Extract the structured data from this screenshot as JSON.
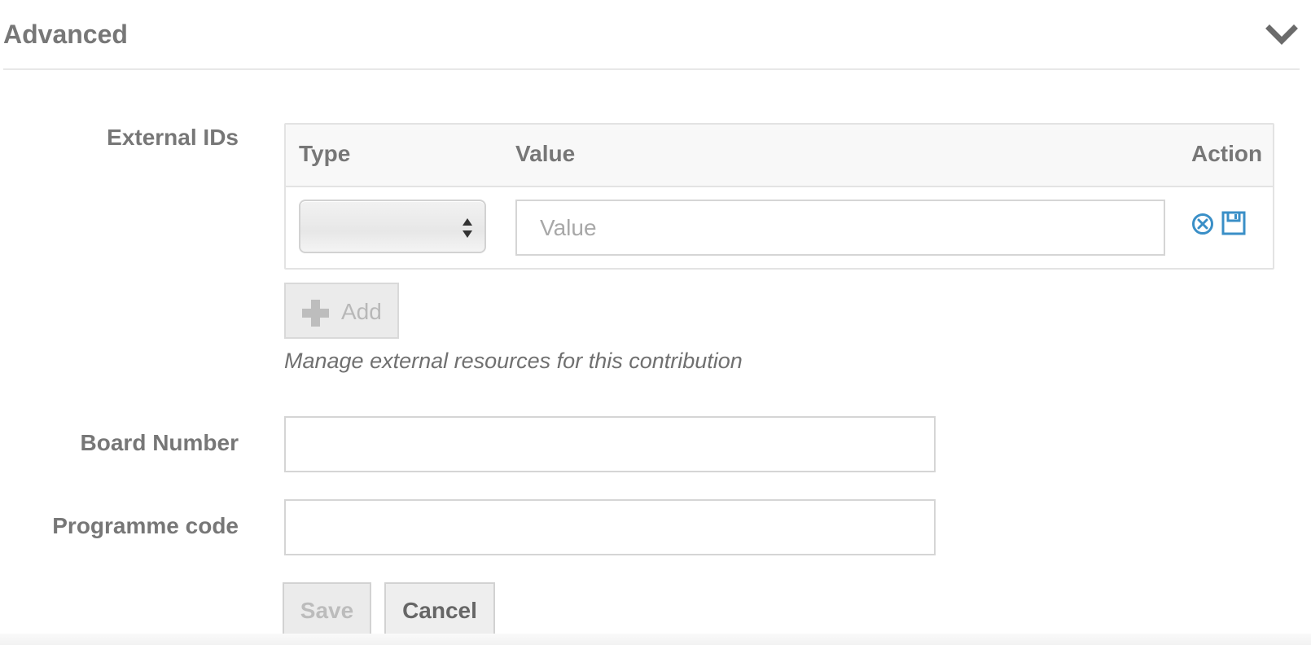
{
  "section": {
    "title": "Advanced"
  },
  "external_ids": {
    "label": "External IDs",
    "columns": {
      "type": "Type",
      "value": "Value",
      "action": "Action"
    },
    "row": {
      "type_selected": "",
      "value": "",
      "value_placeholder": "Value"
    },
    "add_label": "Add",
    "help_text": "Manage external resources for this contribution"
  },
  "board_number": {
    "label": "Board Number",
    "value": ""
  },
  "programme_code": {
    "label": "Programme code",
    "value": ""
  },
  "buttons": {
    "save": "Save",
    "cancel": "Cancel"
  },
  "colors": {
    "accent": "#3a8fc7",
    "label": "#777777"
  }
}
